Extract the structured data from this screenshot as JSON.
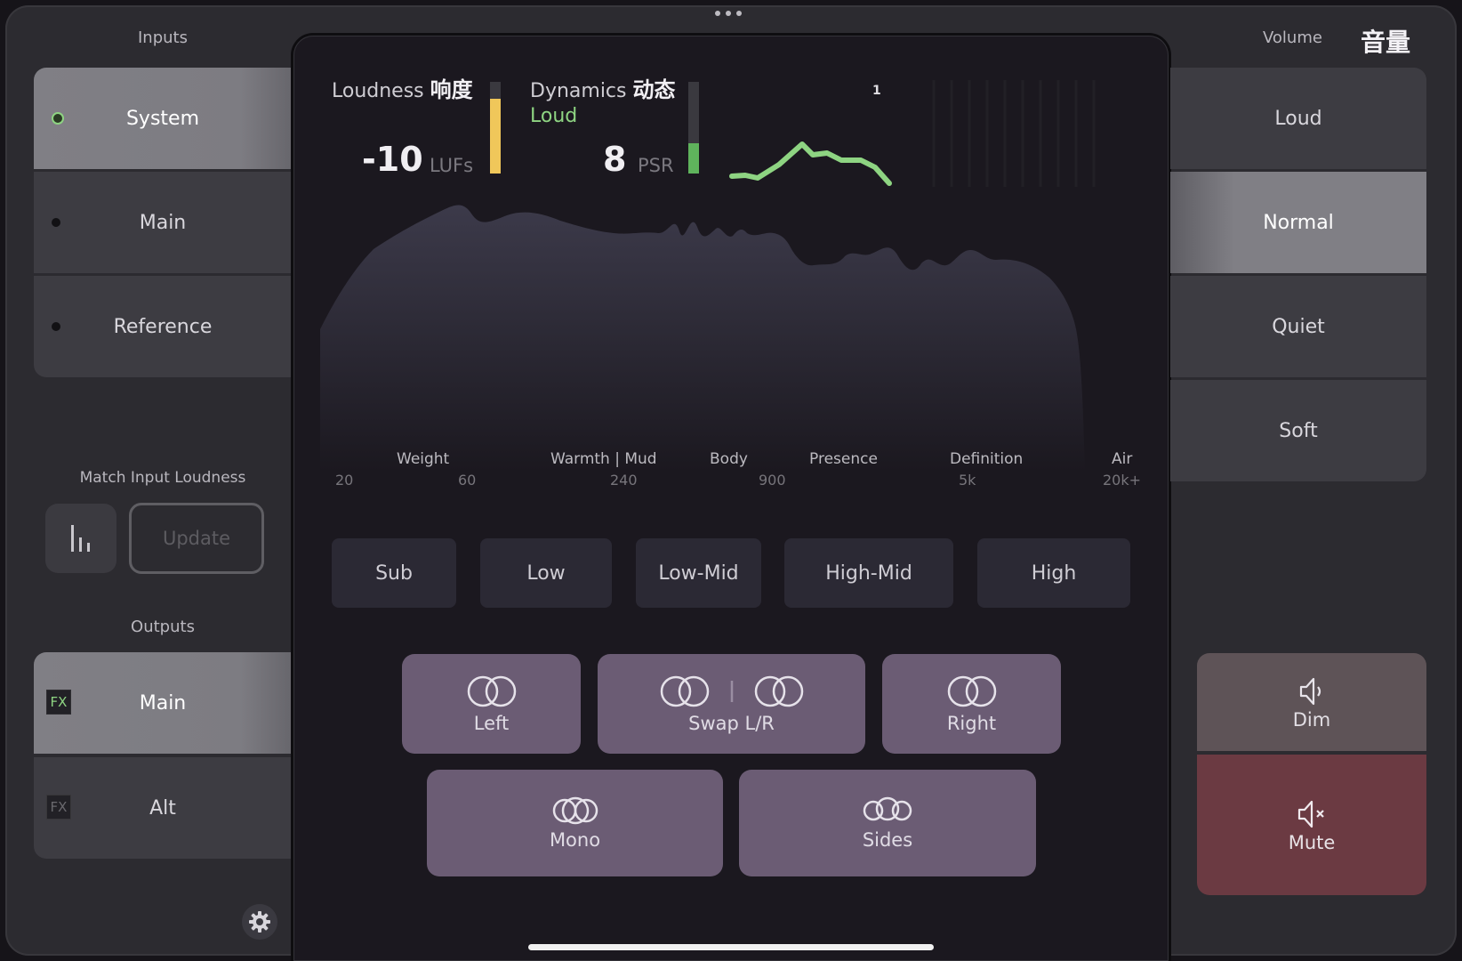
{
  "inputs": {
    "title": "Inputs",
    "items": [
      {
        "label": "System",
        "active": true
      },
      {
        "label": "Main",
        "active": false
      },
      {
        "label": "Reference",
        "active": false
      }
    ]
  },
  "match": {
    "title": "Match Input Loudness",
    "update_label": "Update"
  },
  "outputs": {
    "title": "Outputs",
    "items": [
      {
        "badge": "FX",
        "label": "Main",
        "active": true
      },
      {
        "badge": "FX",
        "label": "Alt",
        "active": false
      }
    ]
  },
  "meters": {
    "loudness_label": "Loudness",
    "loudness_cn": "响度",
    "loudness_value": "-10",
    "loudness_unit": "LUFs",
    "dynamics_label": "Dynamics",
    "dynamics_cn": "动态",
    "dynamics_state": "Loud",
    "dynamics_value": "8",
    "dynamics_unit": "PSR",
    "graph_marker": "1"
  },
  "bands": {
    "names": [
      "Weight",
      "Warmth | Mud",
      "Body",
      "Presence",
      "Definition",
      "Air"
    ],
    "freqs": [
      "20",
      "60",
      "240",
      "900",
      "5k",
      "20k+"
    ],
    "buttons": [
      "Sub",
      "Low",
      "Low-Mid",
      "High-Mid",
      "High"
    ]
  },
  "channels": {
    "left": "Left",
    "swap": "Swap L/R",
    "right": "Right",
    "mono": "Mono",
    "sides": "Sides"
  },
  "volume": {
    "title": "Volume",
    "title_cn": "音量",
    "items": [
      {
        "label": "Loud",
        "active": false
      },
      {
        "label": "Normal",
        "active": true
      },
      {
        "label": "Quiet",
        "active": false
      },
      {
        "label": "Soft",
        "active": false
      }
    ],
    "dim_label": "Dim",
    "mute_label": "Mute"
  },
  "colors": {
    "accent_green": "#8ed482",
    "loudness_bar": "#f0c75a",
    "channel_button": "#6b5c74",
    "dim_button": "#5e5357",
    "mute_button": "#6b3a42"
  }
}
